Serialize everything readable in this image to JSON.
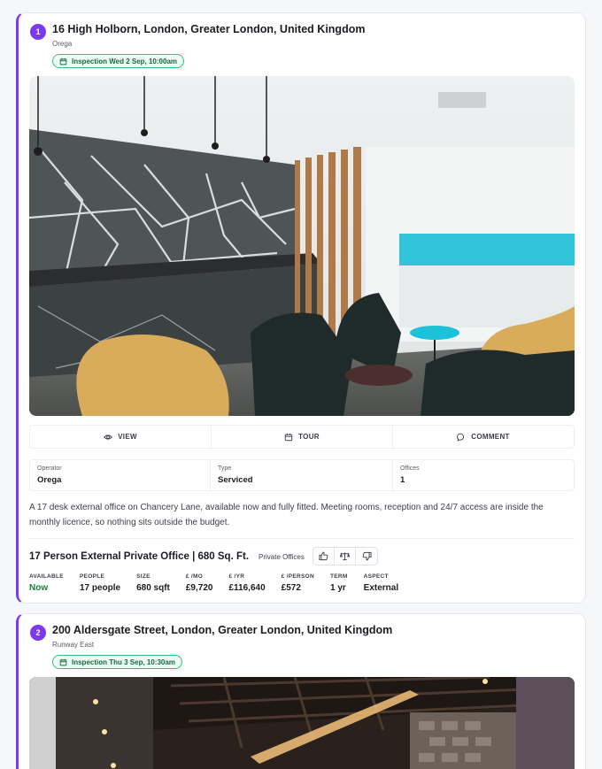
{
  "listings": [
    {
      "number": "1",
      "address": "16 High Holborn, London, Greater London, United Kingdom",
      "operator_sub": "Orega",
      "inspection": "Inspection Wed 2 Sep, 10:00am",
      "actions": {
        "view": "VIEW",
        "tour": "TOUR",
        "comment": "COMMENT"
      },
      "facts": [
        {
          "label": "Operator",
          "value": "Orega"
        },
        {
          "label": "Type",
          "value": "Serviced"
        },
        {
          "label": "Offices",
          "value": "1"
        }
      ],
      "description": "A 17 desk external office on Chancery Lane, available now and fully fitted. Meeting rooms, reception and 24/7 access are inside the monthly licence, so nothing sits outside the budget.",
      "offer": {
        "title": "17 Person External Private Office | 680 Sq. Ft.",
        "type": "Private Offices",
        "stats": [
          {
            "label": "AVAILABLE",
            "value": "Now"
          },
          {
            "label": "PEOPLE",
            "value": "17 people"
          },
          {
            "label": "SIZE",
            "value": "680 sqft"
          },
          {
            "label": "£ /MO",
            "value": "£9,720"
          },
          {
            "label": "£ /YR",
            "value": "£116,640"
          },
          {
            "label": "£ /PERSON",
            "value": "£572"
          },
          {
            "label": "TERM",
            "value": "1 yr"
          },
          {
            "label": "ASPECT",
            "value": "External"
          }
        ]
      }
    },
    {
      "number": "2",
      "address": "200 Aldersgate Street, London, Greater London, United Kingdom",
      "operator_sub": "Runway East",
      "inspection": "Inspection Thu 3 Sep, 10:30am"
    }
  ],
  "icons": {
    "calendar": "calendar-icon",
    "eye": "eye-icon",
    "comment": "comment-bubble-icon",
    "thumbs_up": "thumbs-up-icon",
    "scale": "scale-icon",
    "thumbs_down": "thumbs-down-icon"
  },
  "colors": {
    "accent": "#7c3aed",
    "pill_border": "#34c27a",
    "pill_bg": "#ecfbf3",
    "available": "#15803d"
  }
}
